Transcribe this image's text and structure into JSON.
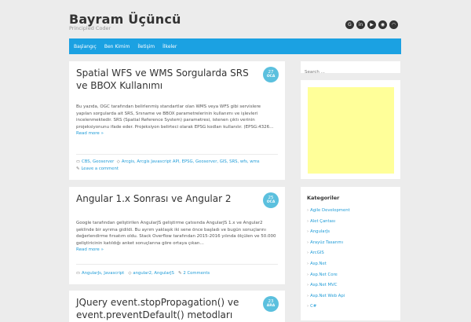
{
  "site": {
    "title": "Bayram Üçüncü",
    "tagline": "Principled Coder"
  },
  "social": [
    {
      "icon": "google-plus-icon",
      "glyph": "G"
    },
    {
      "icon": "linkedin-icon",
      "glyph": "in"
    },
    {
      "icon": "youtube-icon",
      "glyph": "▶"
    },
    {
      "icon": "github-icon",
      "glyph": "◉"
    },
    {
      "icon": "rss-icon",
      "glyph": "◠"
    }
  ],
  "nav": [
    "Başlangıç",
    "Ben Kimim",
    "İletişim",
    "İlkeler"
  ],
  "search": {
    "placeholder": "Search ..."
  },
  "posts": [
    {
      "title": "Spatial WFS ve WMS Sorgularda SRS ve BBOX Kullanımı",
      "day": "27",
      "month": "OCA",
      "excerpt": "Bu yazıda, OGC tarafından belirlenmiş standartlar olan WMS veya WFS gibi servislere yapılan sorgularda ait SRS, Srsname ve BBOX parametrelerinin kullanımı ve işlevleri incelenmektedir. SRS (Spatial Reference System) parametresi, istenen çıktı verinin projeksiyonunu ifade eder. Projeksiyon belirteci olarak EPSG kodları kullanılır. (EPSG:4326…",
      "read_more": "Read more »",
      "categories": "CBS, Geoserver",
      "tags": "Arcgis, Arcgis Javascript API, EPSG, Geoserver, GIS, SRS, wfs, wms",
      "comments": "Leave a comment"
    },
    {
      "title": "Angular 1.x Sonrası ve Angular 2",
      "day": "25",
      "month": "OCA",
      "excerpt": "Google tarafından geliştirilen AngularJS geliştirme çatısında AngularJS 1.x ve Angular2 şeklinde bir ayrıma gidildi. Bu ayrım yaklaşık iki sene önce başladı ve bugün sonuçlarını değerlendirme fırsatım oldu. Stack Overflow tarafından 2015-2016 yılında ölçülen ve 50.000 geliştiricinin katıldığı anket sonuçlarına göre ortaya çıkan…",
      "read_more": "Read more »",
      "categories": "AngularJs, Javascript",
      "tags": "angular2, AngularJS",
      "comments": "2 Comments"
    },
    {
      "title": "JQuery event.stopPropagation() ve event.preventDefault() metodları",
      "day": "23",
      "month": "ARA"
    }
  ],
  "sidebar": {
    "categories_title": "Kategoriler",
    "categories": [
      "Agile Development",
      "Alet Çantası",
      "AngularJs",
      "Arayüz Tasarımı",
      "ArcGIS",
      "Asp.Net",
      "Asp.Net Core",
      "Asp.Net MVC",
      "Asp.Net Web Api",
      "C#"
    ]
  }
}
